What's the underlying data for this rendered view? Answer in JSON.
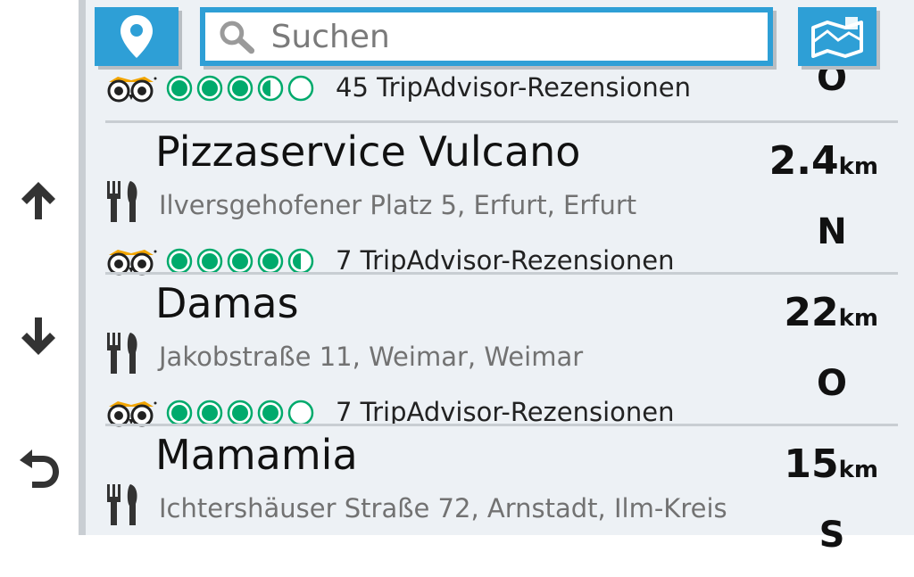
{
  "search": {
    "placeholder": "Suchen"
  },
  "icons": {
    "location": "location-pin-icon",
    "map": "map-icon",
    "search": "search-icon",
    "scroll_up": "arrow-up-icon",
    "scroll_down": "arrow-down-icon",
    "back": "back-arrow-icon",
    "cuisine": "fork-knife-icon",
    "tripadvisor": "tripadvisor-owl-icon"
  },
  "colors": {
    "accent": "#2e9fd6",
    "tripadvisor_green": "#00aa6c",
    "list_background": "#edf1f5"
  },
  "results": [
    {
      "name": "",
      "address": "",
      "rating": 3.5,
      "reviews": "45 TripAdvisor-Rezensionen",
      "distance": "",
      "unit": "",
      "direction": "O"
    },
    {
      "name": "Pizzaservice Vulcano",
      "address": "Ilversgehofener Platz 5, Erfurt, Erfurt",
      "rating": 4.5,
      "reviews": "7 TripAdvisor-Rezensionen",
      "distance": "2.4",
      "unit": "km",
      "direction": "N"
    },
    {
      "name": "Damas",
      "address": "Jakobstraße 11, Weimar, Weimar",
      "rating": 4,
      "reviews": "7 TripAdvisor-Rezensionen",
      "distance": "22",
      "unit": "km",
      "direction": "O"
    },
    {
      "name": "Mamamia",
      "address": "Ichtershäuser Straße 72, Arnstadt, Ilm-Kreis",
      "rating": null,
      "reviews": "",
      "distance": "15",
      "unit": "km",
      "direction": "S"
    }
  ]
}
